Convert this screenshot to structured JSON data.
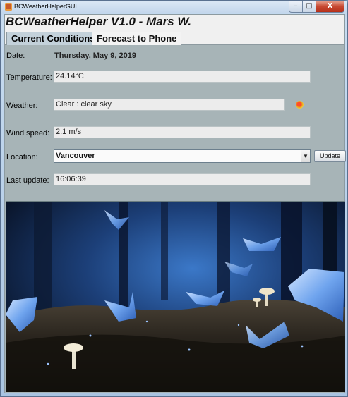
{
  "window": {
    "title": "BCWeatherHelperGUI",
    "controls": {
      "minimize": "–",
      "maximize": "□",
      "close": "X"
    }
  },
  "app": {
    "heading": "BCWeatherHelper V1.0 - Mars W."
  },
  "tabs": [
    {
      "label": "Current Conditions",
      "active": true
    },
    {
      "label": "Forecast to Phone",
      "active": false
    }
  ],
  "conditions": {
    "date_label": "Date:",
    "date_value": "Thursday, May 9, 2019",
    "temperature_label": "Temperature:",
    "temperature_value": "24.14°C",
    "weather_label": "Weather:",
    "weather_value": "Clear : clear sky",
    "weather_icon": "sun-icon",
    "wind_label": "Wind speed:",
    "wind_value": "2.1 m/s",
    "location_label": "Location:",
    "location_value": "Vancouver",
    "update_button": "Update",
    "last_update_label": "Last update:",
    "last_update_value": "16:06:39"
  },
  "background_image": {
    "icon": "forest-butterflies-image"
  },
  "colors": {
    "panel_bg": "#a7b4b7",
    "field_bg": "#ececec",
    "active_tab": "#c3d1da"
  }
}
